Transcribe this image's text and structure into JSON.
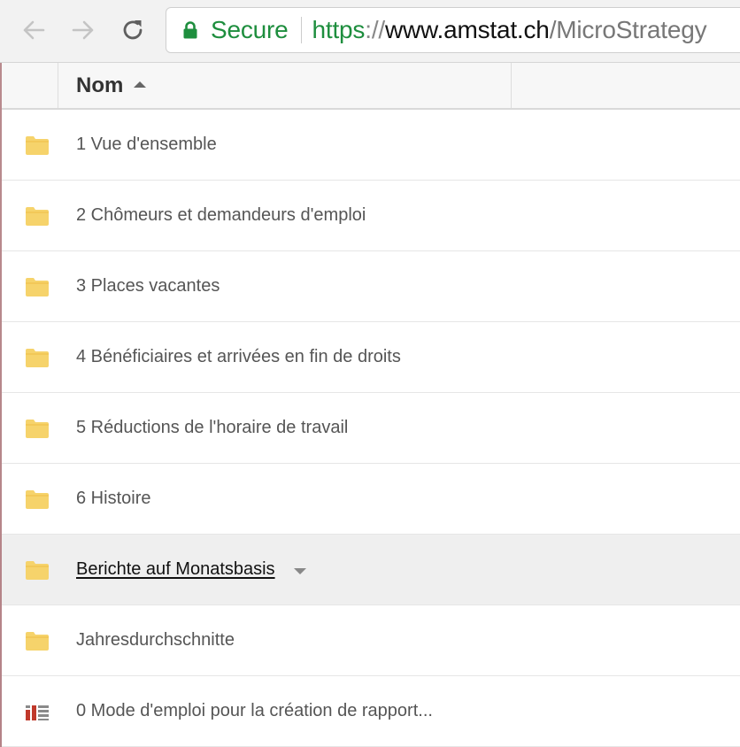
{
  "browser": {
    "secure_label": "Secure",
    "url": {
      "scheme": "https",
      "separator": "://",
      "host": "www.amstat.ch",
      "path": "/MicroStrategy"
    },
    "icons": {
      "back": "arrow-left-icon",
      "forward": "arrow-right-icon",
      "reload": "reload-icon",
      "lock": "lock-icon"
    },
    "colors": {
      "secure": "#1e8e3e"
    }
  },
  "table": {
    "columns": [
      {
        "label": "Nom",
        "sort": "ascending"
      }
    ],
    "rows": [
      {
        "label": "1 Vue d'ensemble",
        "icon": "folder-icon"
      },
      {
        "label": "2 Chômeurs et demandeurs d'emploi",
        "icon": "folder-icon"
      },
      {
        "label": "3 Places vacantes",
        "icon": "folder-icon"
      },
      {
        "label": "4 Bénéficiaires et arrivées en fin de droits",
        "icon": "folder-icon"
      },
      {
        "label": "5 Réductions de l'horaire de travail",
        "icon": "folder-icon"
      },
      {
        "label": "6 Histoire",
        "icon": "folder-icon"
      },
      {
        "label": "Berichte auf Monatsbasis",
        "icon": "folder-icon",
        "hovered": true
      },
      {
        "label": "Jahresdurchschnitte",
        "icon": "folder-icon"
      },
      {
        "label": "0 Mode d'emploi pour la création de rapport...",
        "icon": "report-icon"
      }
    ],
    "colors": {
      "folder": "#f6d36b",
      "report_red": "#c0392b",
      "report_gray": "#8a8a8a"
    }
  }
}
